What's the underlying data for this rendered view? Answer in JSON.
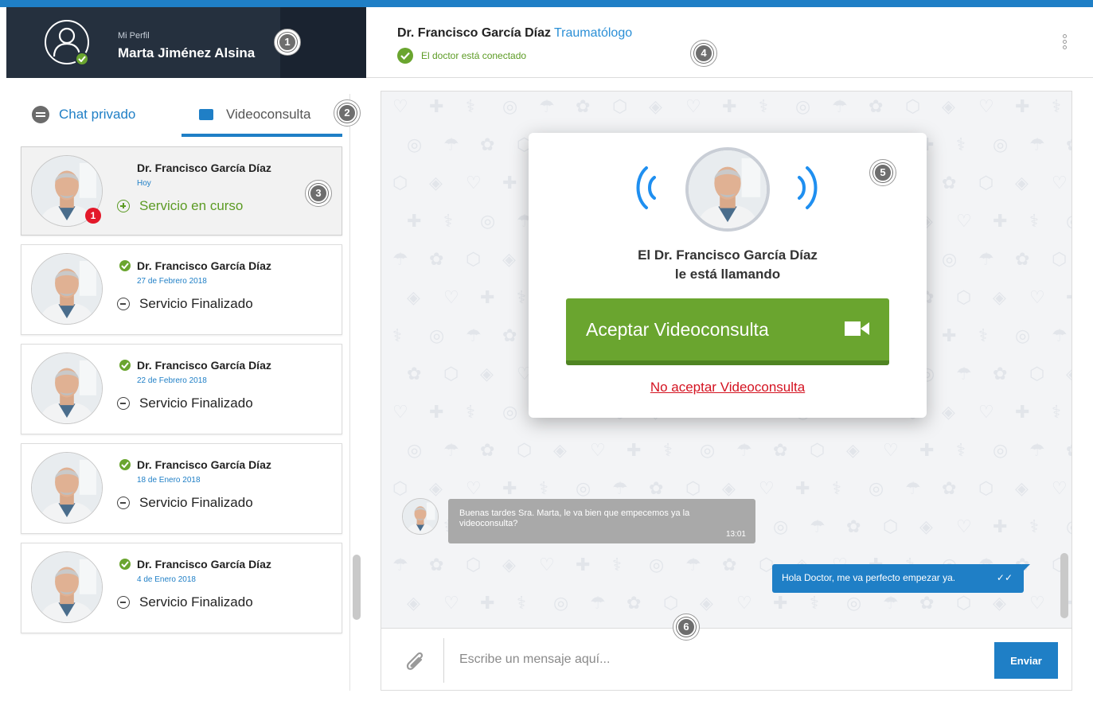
{
  "profile": {
    "label": "Mi Perfil",
    "name": "Marta Jiménez Alsina",
    "avatar_icon": "user-outline-icon",
    "online_icon": "check-icon"
  },
  "markers": [
    "1",
    "2",
    "3",
    "4",
    "5",
    "6"
  ],
  "chat_header": {
    "doctor_name": "Dr. Francisco García Díaz",
    "specialty": "Traumatólogo",
    "status": "El doctor está conectado",
    "menu_icon": "more-vertical-icon"
  },
  "tabs": [
    {
      "label": "Chat privado",
      "icon": "chat-bubble-icon",
      "active": false
    },
    {
      "label": "Videoconsulta",
      "icon": "video-icon",
      "active": true
    }
  ],
  "consultations": [
    {
      "doctor": "Dr. Francisco García Díaz",
      "date": "Hoy",
      "status": "Servicio en curso",
      "state": "running",
      "unread": "1",
      "verified": false
    },
    {
      "doctor": "Dr. Francisco García Díaz",
      "date": "27 de Febrero 2018",
      "status": "Servicio Finalizado",
      "state": "done",
      "unread": null,
      "verified": true
    },
    {
      "doctor": "Dr. Francisco García Díaz",
      "date": "22 de Febrero 2018",
      "status": "Servicio Finalizado",
      "state": "done",
      "unread": null,
      "verified": true
    },
    {
      "doctor": "Dr. Francisco García Díaz",
      "date": "18 de Enero 2018",
      "status": "Servicio Finalizado",
      "state": "done",
      "unread": null,
      "verified": true
    },
    {
      "doctor": "Dr. Francisco García Díaz",
      "date": "4 de Enero 2018",
      "status": "Servicio Finalizado",
      "state": "done",
      "unread": null,
      "verified": true
    }
  ],
  "messages": {
    "incoming": {
      "text": "Buenas tardes Sra. Marta, le va bien que empecemos ya la videoconsulta?",
      "time": "13:01"
    },
    "outgoing": {
      "text": "Hola Doctor, me va perfecto empezar ya.",
      "ticks": "✓✓"
    }
  },
  "call_modal": {
    "caller_line1": "El Dr. Francisco García Díaz",
    "caller_line2": "le está llamando",
    "accept_label": "Aceptar Videoconsulta",
    "accept_icon": "video-camera-icon",
    "decline_label": "No aceptar Videoconsulta"
  },
  "composer": {
    "placeholder": "Escribe un mensaje aquí...",
    "attach_icon": "paperclip-icon",
    "send_label": "Enviar"
  },
  "colors": {
    "brand_blue": "#1f7fc6",
    "accept_green": "#6aa52f",
    "decline_red": "#d41321",
    "profile_dark": "#25303e",
    "alert_red": "#e3192a"
  }
}
